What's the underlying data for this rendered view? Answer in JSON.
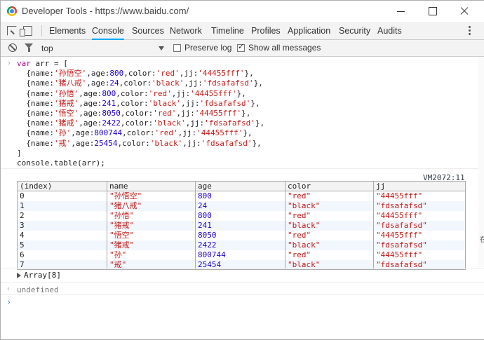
{
  "window": {
    "title": "Developer Tools - https://www.baidu.com/"
  },
  "tabs": [
    "Elements",
    "Console",
    "Sources",
    "Network",
    "Timeline",
    "Profiles",
    "Application",
    "Security",
    "Audits"
  ],
  "toolbar": {
    "context": "top",
    "preserve_log_label": "Preserve log",
    "preserve_log_checked": false,
    "show_all_label": "Show all messages",
    "show_all_checked": true
  },
  "code": [
    "var arr = [",
    "  {name:'孙悟空',age:800,color:'red',jj:'44455fff'},",
    "  {name:'猪八戒',age:24,color:'black',jj:'fdsafafsd'},",
    "  {name:'孙悟',age:800,color:'red',jj:'44455fff'},",
    "  {name:'猪戒',age:241,color:'black',jj:'fdsafafsd'},",
    "  {name:'悟空',age:8050,color:'red',jj:'44455fff'},",
    "  {name:'猪戒',age:2422,color:'black',jj:'fdsafafsd'},",
    "  {name:'孙',age:800744,color:'red',jj:'44455fff'},",
    "  {name:'戒',age:25454,color:'black',jj:'fdsafafsd'},",
    "]",
    "console.table(arr);"
  ],
  "source_link": "VM2072:11",
  "table": {
    "headers": [
      "(index)",
      "name",
      "age",
      "color",
      "jj"
    ],
    "rows": [
      [
        "0",
        "\"孙悟空\"",
        "800",
        "\"red\"",
        "\"44455fff\""
      ],
      [
        "1",
        "\"猪八戒\"",
        "24",
        "\"black\"",
        "\"fdsafafsd\""
      ],
      [
        "2",
        "\"孙悟\"",
        "800",
        "\"red\"",
        "\"44455fff\""
      ],
      [
        "3",
        "\"猪戒\"",
        "241",
        "\"black\"",
        "\"fdsafafsd\""
      ],
      [
        "4",
        "\"悟空\"",
        "8050",
        "\"red\"",
        "\"44455fff\""
      ],
      [
        "5",
        "\"猪戒\"",
        "2422",
        "\"black\"",
        "\"fdsafafsd\""
      ],
      [
        "6",
        "\"孙\"",
        "800744",
        "\"red\"",
        "\"44455fff\""
      ],
      [
        "7",
        "\"戒\"",
        "25454",
        "\"black\"",
        "\"fdsafafsd\""
      ]
    ]
  },
  "array_summary": "Array[8]",
  "result": "undefined",
  "side_glyph": "在",
  "colors": {
    "string": "#c41a16",
    "number": "#1c00cf",
    "keyword": "#aa0d91",
    "active_tab": "#03a9f4"
  },
  "icons": [
    "chrome-logo",
    "inspect-icon",
    "device-icon",
    "more-icon",
    "clear-icon",
    "filter-icon",
    "chevron-down-icon"
  ]
}
